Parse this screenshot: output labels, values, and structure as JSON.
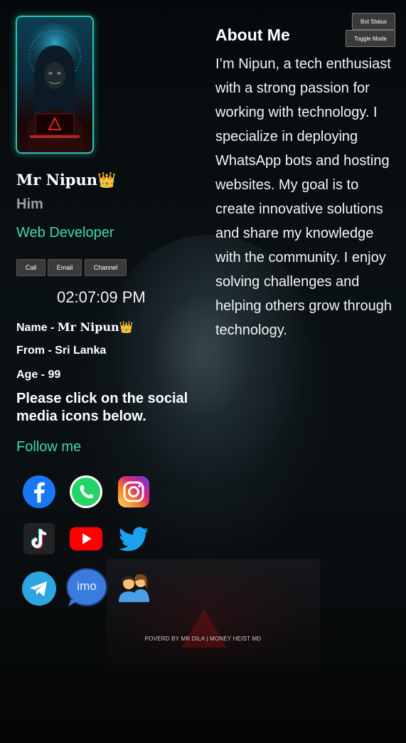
{
  "buttons": {
    "bot_status": "Bot Status",
    "toggle_mode": "Toggle Mode"
  },
  "profile": {
    "name": "Mr Nipun",
    "crown": "👑",
    "pronoun": "Him",
    "role": "Web Developer",
    "avatar_icon": "hacker-avatar-icon",
    "accent_color": "#3fd8b2"
  },
  "contact_buttons": [
    {
      "label": "Call"
    },
    {
      "label": "Email"
    },
    {
      "label": "Channel"
    }
  ],
  "clock": {
    "time": "02:07:09 PM"
  },
  "info": {
    "name_label": "Name - ",
    "name_value": "Mr Nipun",
    "from": "From - Sri Lanka",
    "age": "Age - 99"
  },
  "notice": "Please click on the social media icons below.",
  "follow": {
    "title": "Follow me"
  },
  "socials": [
    {
      "name": "facebook-icon"
    },
    {
      "name": "whatsapp-icon"
    },
    {
      "name": "instagram-icon"
    },
    {
      "name": "tiktok-icon"
    },
    {
      "name": "youtube-icon"
    },
    {
      "name": "twitter-icon"
    },
    {
      "name": "telegram-icon"
    },
    {
      "name": "imo-icon",
      "label": "imo"
    },
    {
      "name": "people-icon"
    }
  ],
  "about": {
    "title": "About Me",
    "text": "I’m Nipun, a tech enthusiast with a strong passion for working with technology. I specialize in deploying WhatsApp bots and hosting websites. My goal is to create innovative solutions and share my knowledge with the community. I enjoy solving challenges and helping others grow through technology."
  },
  "footer": "POVERD BY MR DILA | MONEY HEIST MD"
}
